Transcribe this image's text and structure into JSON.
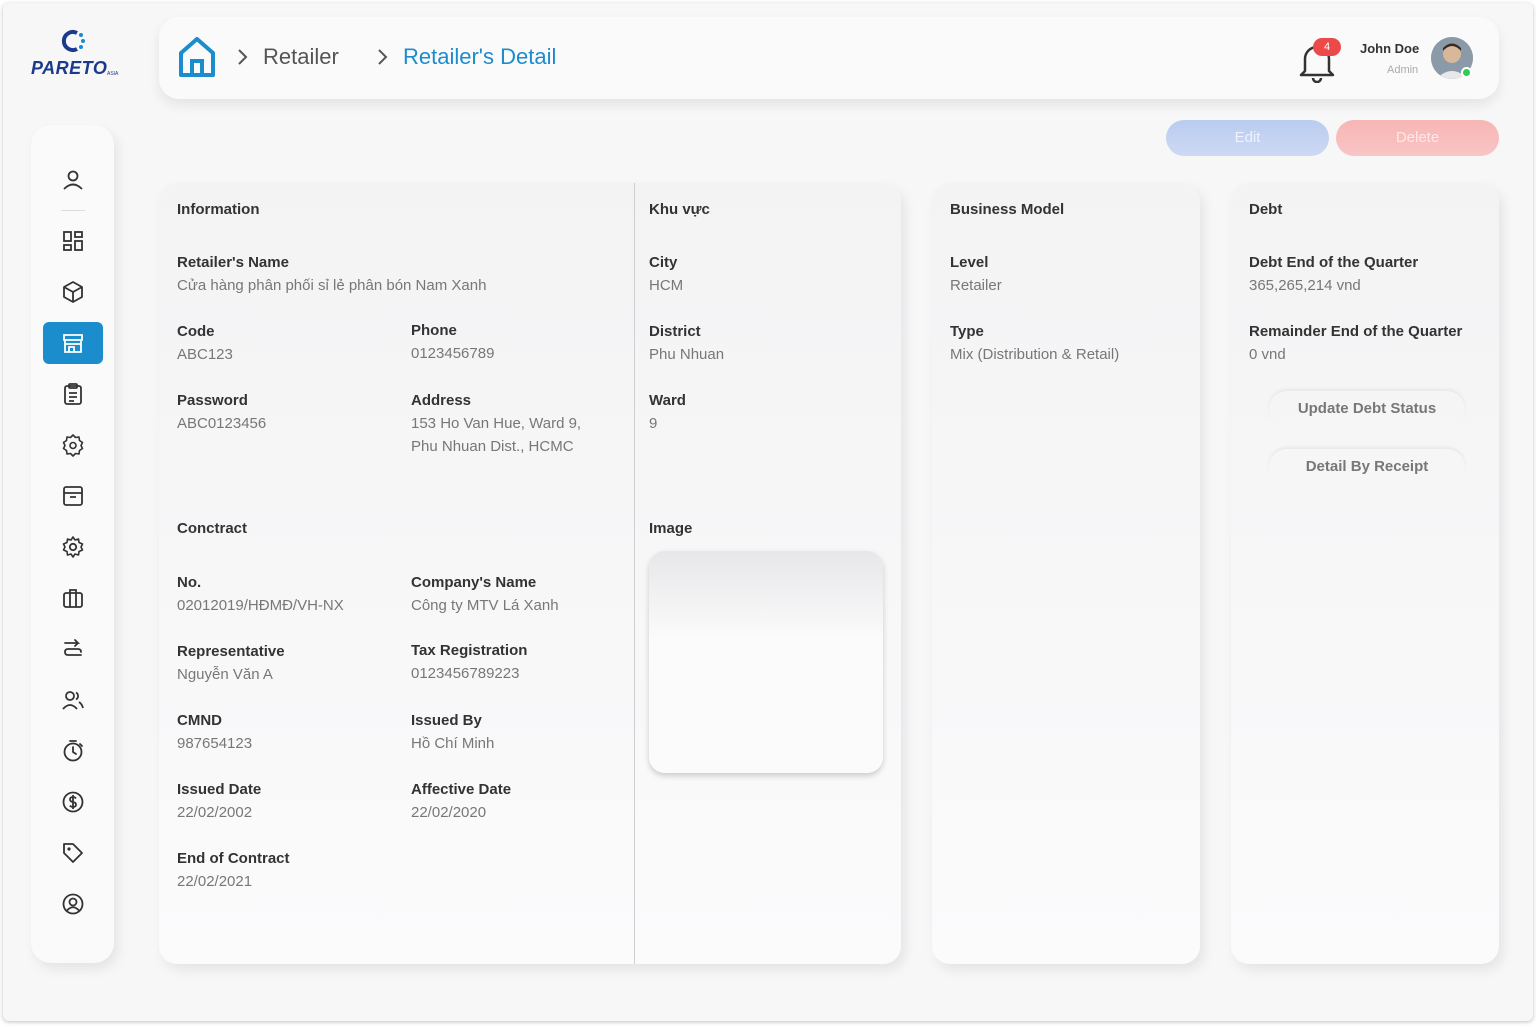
{
  "brand": {
    "name": "PARETO",
    "sub": "ASIA",
    "color": "#1b3a8c"
  },
  "header": {
    "breadcrumbs": [
      "Retailer",
      "Retailer's Detail"
    ],
    "notification_count": "4",
    "user": {
      "name": "John Doe",
      "role": "Admin"
    }
  },
  "actions": {
    "edit": "Edit",
    "delete": "Delete"
  },
  "sidebar": {
    "items": [
      {
        "icon": "user-icon"
      },
      {
        "icon": "dashboard-icon"
      },
      {
        "icon": "box-icon"
      },
      {
        "icon": "store-icon",
        "active": true
      },
      {
        "icon": "clipboard-icon"
      },
      {
        "icon": "badge-settings-icon"
      },
      {
        "icon": "archive-icon"
      },
      {
        "icon": "gear-icon"
      },
      {
        "icon": "briefcase-icon"
      },
      {
        "icon": "route-icon"
      },
      {
        "icon": "users-icon"
      },
      {
        "icon": "timer-icon"
      },
      {
        "icon": "dollar-icon"
      },
      {
        "icon": "tag-icon"
      },
      {
        "icon": "profile-circle-icon"
      }
    ],
    "accent": "#1b8ccc"
  },
  "information": {
    "title": "Information",
    "retailer_name_label": "Retailer's Name",
    "retailer_name": "Cửa hàng phân phối sỉ lẻ phân bón Nam Xanh",
    "code_label": "Code",
    "code": "ABC123",
    "phone_label": "Phone",
    "phone": "0123456789",
    "password_label": "Password",
    "password": "ABC0123456",
    "address_label": "Address",
    "address_line1": "153 Ho Van Hue, Ward 9,",
    "address_line2": "Phu Nhuan Dist., HCMC"
  },
  "contract": {
    "title": "Conctract",
    "no_label": "No.",
    "no": "02012019/HĐMĐ/VH-NX",
    "company_label": "Company's Name",
    "company": "Công ty MTV Lá Xanh",
    "representative_label": "Representative",
    "representative": "Nguyễn Văn A",
    "tax_label": "Tax Registration",
    "tax": "0123456789223",
    "cmnd_label": "CMND",
    "cmnd": "987654123",
    "issued_by_label": "Issued By",
    "issued_by": "Hồ Chí Minh",
    "issued_date_label": "Issued Date",
    "issued_date": "22/02/2002",
    "affective_label": "Affective Date",
    "affective": "22/02/2020",
    "end_label": "End of Contract",
    "end": "22/02/2021"
  },
  "area": {
    "title": "Khu vực",
    "city_label": "City",
    "city": "HCM",
    "district_label": "District",
    "district": "Phu Nhuan",
    "ward_label": "Ward",
    "ward": "9",
    "image_label": "Image"
  },
  "business": {
    "title": "Business Model",
    "level_label": "Level",
    "level": "Retailer",
    "type_label": "Type",
    "type": "Mix (Distribution & Retail)"
  },
  "debt": {
    "title": "Debt",
    "end_quarter_label": "Debt End of the Quarter",
    "end_quarter": "365,265,214 vnd",
    "remainder_label": "Remainder End of the Quarter",
    "remainder": "0 vnd",
    "update_button": "Update Debt Status",
    "receipt_button": "Detail By Receipt"
  }
}
